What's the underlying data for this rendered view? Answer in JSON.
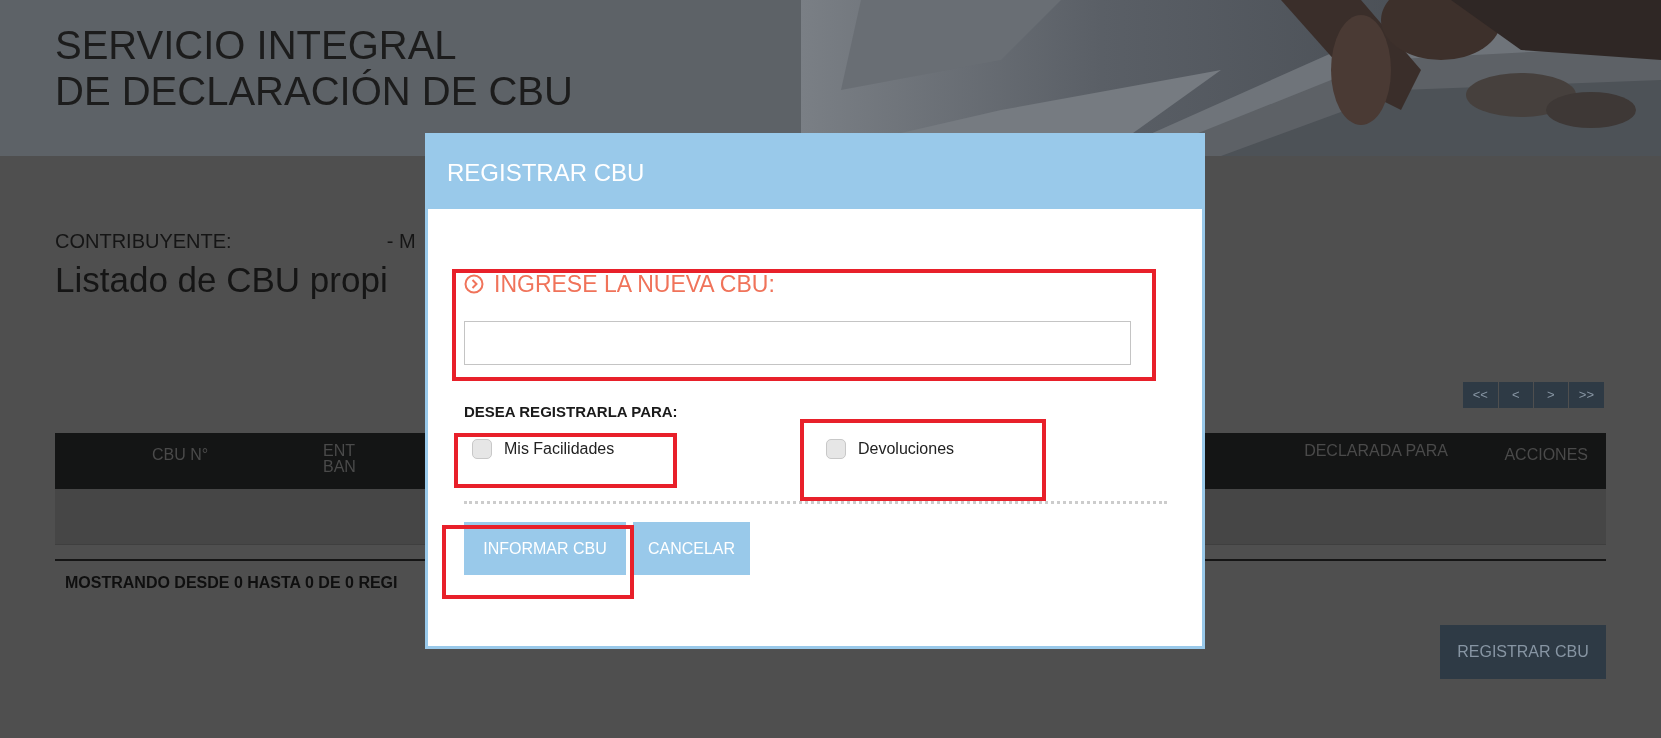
{
  "header": {
    "title_lines": [
      "SERVICIO INTEGRAL",
      "DE DECLARACIÓN DE CBU"
    ]
  },
  "taxpayer": {
    "label": "CONTRIBUYENTE:",
    "value": "- M"
  },
  "list_title": "Listado de CBU propi",
  "pagination": [
    "<<",
    "<",
    ">",
    ">>"
  ],
  "table": {
    "columns": [
      {
        "label": "CBU N°",
        "kind": "left"
      },
      {
        "label": "ENT BAN",
        "kind": "cut"
      },
      {
        "label": "DECLARADA PARA",
        "kind": "mid"
      },
      {
        "label": "ACCIONES",
        "kind": "right"
      }
    ]
  },
  "summary": "MOSTRANDO DESDE 0 HASTA 0 DE 0 REGI",
  "register_button": "REGISTRAR CBU",
  "dialog": {
    "title": "REGISTRAR CBU",
    "field_label": "INGRESE LA NUEVA CBU:",
    "question": "DESEA REGISTRARLA PARA:",
    "options": [
      {
        "label": "Mis Facilidades",
        "checked": false
      },
      {
        "label": "Devoluciones",
        "checked": false
      }
    ],
    "buttons": [
      {
        "label": "INFORMAR CBU",
        "kind": "primary"
      },
      {
        "label": "CANCELAR",
        "kind": "secondary"
      }
    ]
  }
}
